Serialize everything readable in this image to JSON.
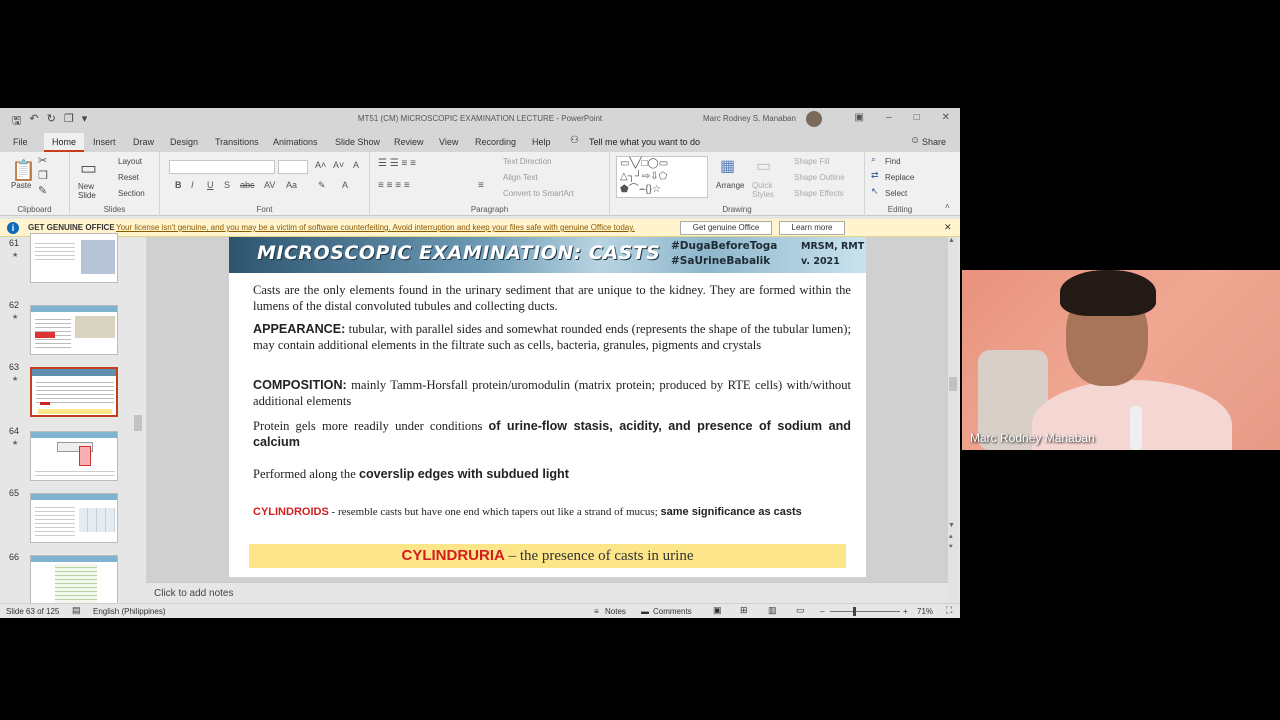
{
  "titlebar": {
    "doc_title": "MT51 (CM) MICROSCOPIC EXAMINATION LECTURE - PowerPoint",
    "user": "Marc Rodney S. Manaban"
  },
  "tabs": [
    "File",
    "Home",
    "Insert",
    "Draw",
    "Design",
    "Transitions",
    "Animations",
    "Slide Show",
    "Review",
    "View",
    "Recording",
    "Help"
  ],
  "tell_me": "Tell me what you want to do",
  "share": "Share",
  "ribbon": {
    "clipboard": {
      "paste": "Paste",
      "label": "Clipboard"
    },
    "slides": {
      "new_slide": "New Slide",
      "layout": "Layout",
      "reset": "Reset",
      "section": "Section",
      "label": "Slides"
    },
    "font": {
      "label": "Font"
    },
    "paragraph": {
      "text_direction": "Text Direction",
      "align_text": "Align Text",
      "convert": "Convert to SmartArt",
      "label": "Paragraph"
    },
    "drawing": {
      "arrange": "Arrange",
      "quick_styles": "Quick Styles",
      "shape_fill": "Shape Fill",
      "shape_outline": "Shape Outline",
      "shape_effects": "Shape Effects",
      "label": "Drawing"
    },
    "editing": {
      "find": "Find",
      "replace": "Replace",
      "select": "Select",
      "label": "Editing"
    }
  },
  "message_bar": {
    "title": "GET GENUINE OFFICE",
    "text": "Your license isn't genuine, and you may be a victim of software counterfeiting. Avoid interruption and keep your files safe with genuine Office today.",
    "btn1": "Get genuine Office",
    "btn2": "Learn more"
  },
  "thumbnails": [
    {
      "num": "61",
      "star": "★"
    },
    {
      "num": "62",
      "star": "★"
    },
    {
      "num": "63",
      "star": "★"
    },
    {
      "num": "64",
      "star": "★"
    },
    {
      "num": "65",
      "star": ""
    },
    {
      "num": "66",
      "star": ""
    }
  ],
  "slide": {
    "title": "MICROSCOPIC EXAMINATION: CASTS",
    "tag1": "#DugaBeforeToga",
    "tag2": "#SaUrineBabalik",
    "mrsm": "MRSM, RMT",
    "version": "v. 2021",
    "p1": "Casts are the only elements found in the urinary sediment that are unique to the kidney. They are formed within the lumens of the distal convoluted tubules and collecting ducts.",
    "appearance_label": "APPEARANCE:",
    "appearance_text": " tubular, with parallel sides and somewhat rounded ends (represents the shape of the tubular lumen); may contain additional elements in the filtrate such as cells, bacteria, granules, pigments and crystals",
    "composition_label": "COMPOSITION:",
    "composition_text": " mainly Tamm-Horsfall protein/uromodulin (matrix protein; produced by RTE cells) with/without additional elements",
    "protein_text": "Protein gels more readily under conditions ",
    "protein_bold": "of urine-flow stasis, acidity, and presence of sodium and calcium",
    "performed_text": "Performed along the ",
    "performed_bold": "coverslip edges with subdued light",
    "cylindroids_label": "CYLINDROIDS",
    "cylindroids_text": " - resemble casts but have one end which tapers out like a strand of mucus; ",
    "cylindroids_bold": "same significance as casts",
    "cylindruria_label": "CYLINDRURIA",
    "cylindruria_text": " – the presence of casts in urine"
  },
  "notes_placeholder": "Click to add notes",
  "status": {
    "slide_count": "Slide 63 of 125",
    "language": "English (Philippines)",
    "notes": "Notes",
    "comments": "Comments",
    "zoom": "71%"
  },
  "webcam": {
    "name": "Marc Rodney Manaban"
  }
}
